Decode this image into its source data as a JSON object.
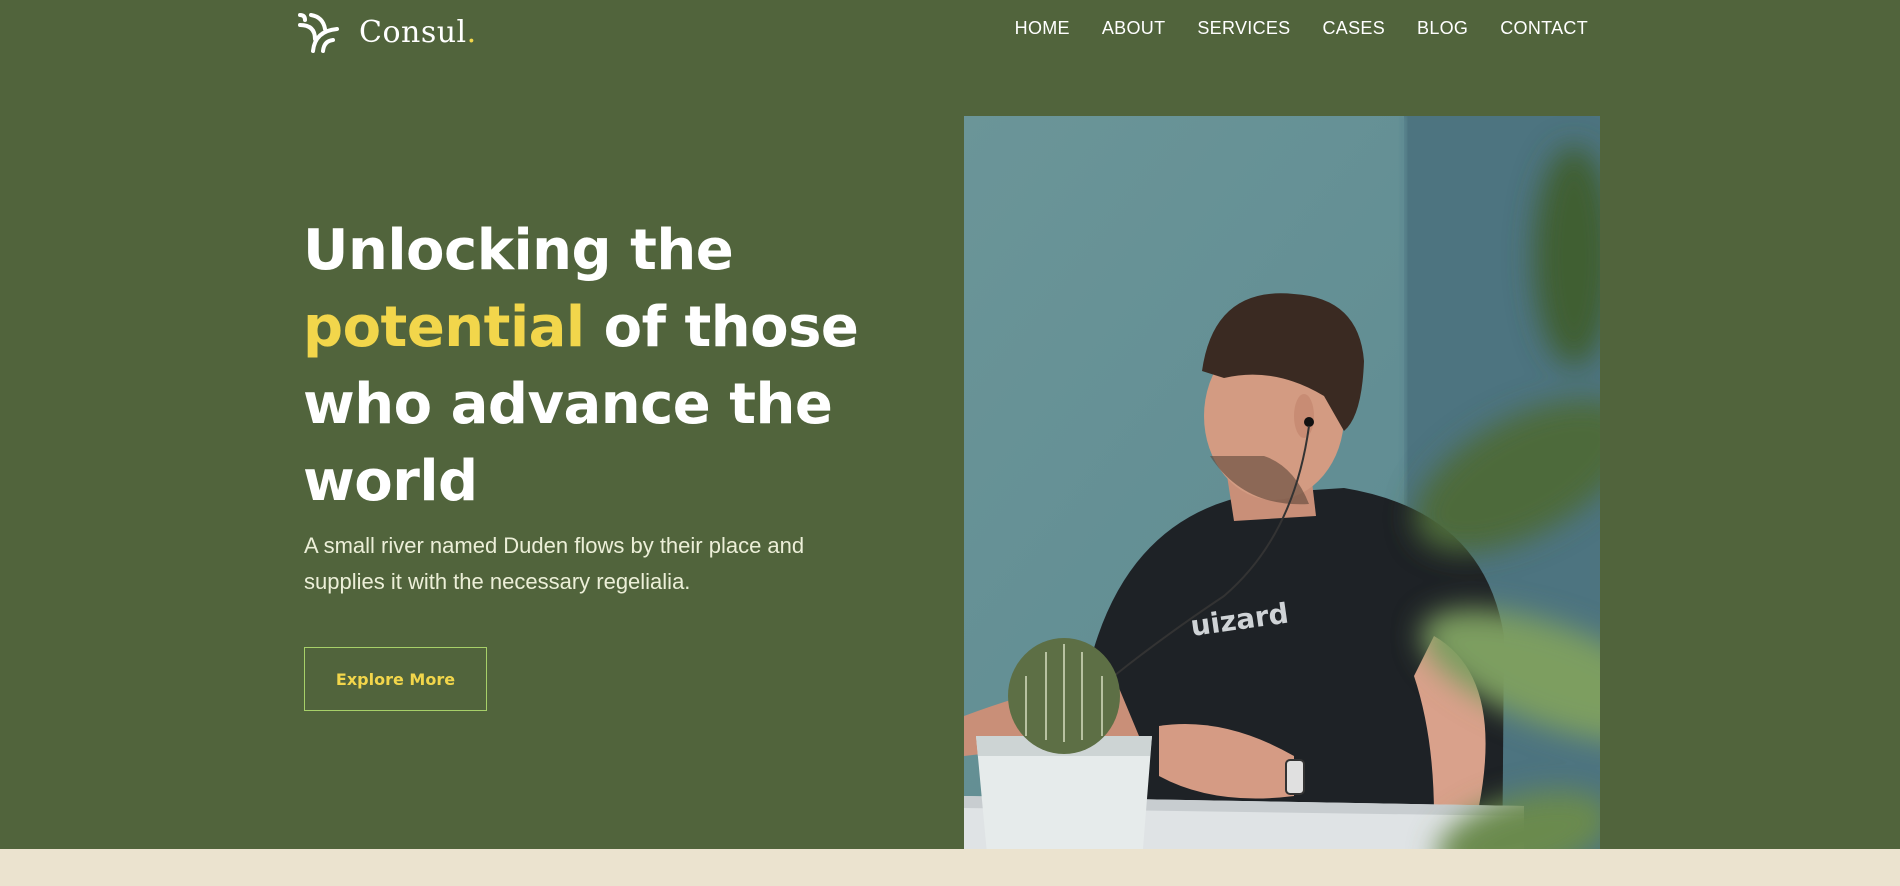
{
  "brand": {
    "name": "Consul",
    "dot": "."
  },
  "nav": {
    "home": "HOME",
    "about": "ABOUT",
    "services": "SERVICES",
    "cases": "CASES",
    "blog": "BLOG",
    "contact": "CONTACT"
  },
  "hero": {
    "title_line1": "Unlocking the",
    "title_accent": "potential",
    "title_line2_rest": " of those",
    "title_line3": "who advance the",
    "title_line4": "world",
    "description": "A small river named Duden flows by their place and supplies it with the necessary regelialia.",
    "cta": "Explore More",
    "photo_shirt_text": "uizard"
  },
  "colors": {
    "background": "#51643c",
    "accent": "#f2d64b",
    "button_border": "#a7d069",
    "bottom_band": "#ebe3cf"
  },
  "icons": {
    "logo": "signal-waves-icon"
  }
}
